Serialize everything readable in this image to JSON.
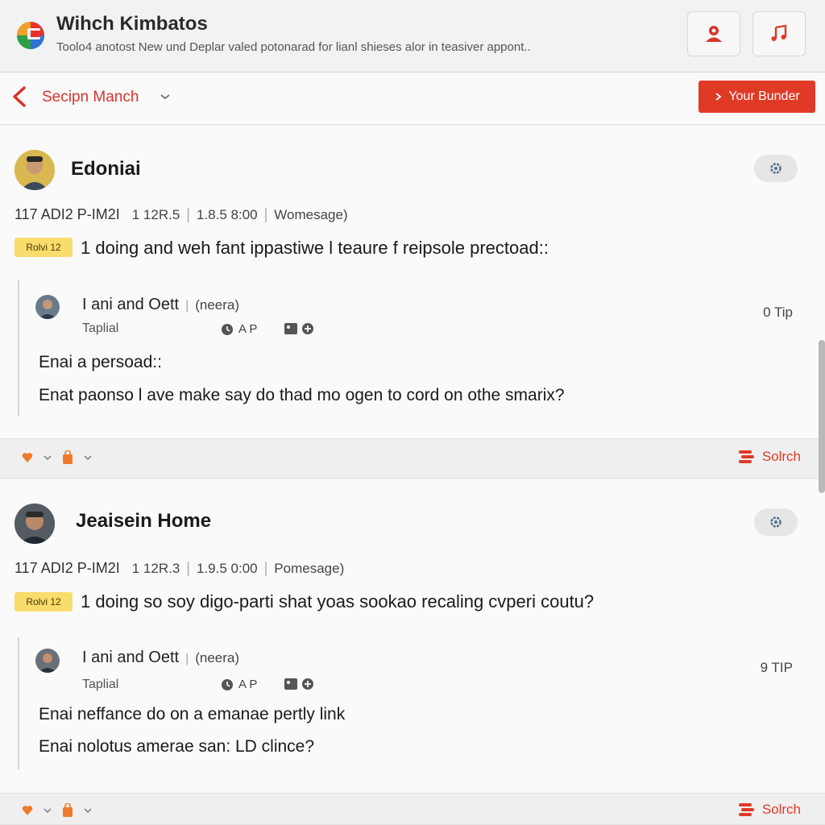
{
  "header": {
    "title": "Wihch Kimbatos",
    "subtitle": "Toolo4 anotost New und Deplar valed potonarad for lianl shieses alor in teasiver appont..",
    "btn_person_icon": "person-alert-icon",
    "btn_music_icon": "music-note-icon"
  },
  "subnav": {
    "label": "Secipn Manch",
    "action_label": "Your Bunder"
  },
  "posts": [
    {
      "author": "Edoniai",
      "meta": {
        "date": "117 ADI2 P-IM2I",
        "a": "1 12R.5",
        "b": "1.8.5 8:00",
        "c": "Womesage)"
      },
      "badge": "Rolvi 12",
      "text": "1 doing and weh fant ippastiwe l teaure f reipsole prectoad::",
      "reply": {
        "author": "I ani and Oett",
        "role": "(neera)",
        "tip": "0 Tip",
        "sub": "Taplial",
        "icons_text": "A P",
        "line1": "Enai a persoad::",
        "line2": "Enat paonso l ave make say do thad mo ogen to cord on othe smarix?"
      },
      "action": "Solrch"
    },
    {
      "author": "Jeaisein Home",
      "meta": {
        "date": "117 ADI2 P-IM2I",
        "a": "1 12R.3",
        "b": "1.9.5 0:00",
        "c": "Pomesage)"
      },
      "badge": "Rolvi 12",
      "text": "1 doing so soy digo-parti shat yoas sookao recaling cvperi coutu?",
      "reply": {
        "author": "I ani and Oett",
        "role": "(neera)",
        "tip": "9 TIP",
        "sub": "Taplial",
        "icons_text": "A P",
        "line1": "Enai neffance do on a emanae pertly link",
        "line2": "Enai nolotus amerae san: LD clince?"
      },
      "action": "Solrch"
    }
  ],
  "colors": {
    "accent": "#e03a26",
    "badge": "#f8dc6c",
    "action_orange": "#f07a2a"
  }
}
